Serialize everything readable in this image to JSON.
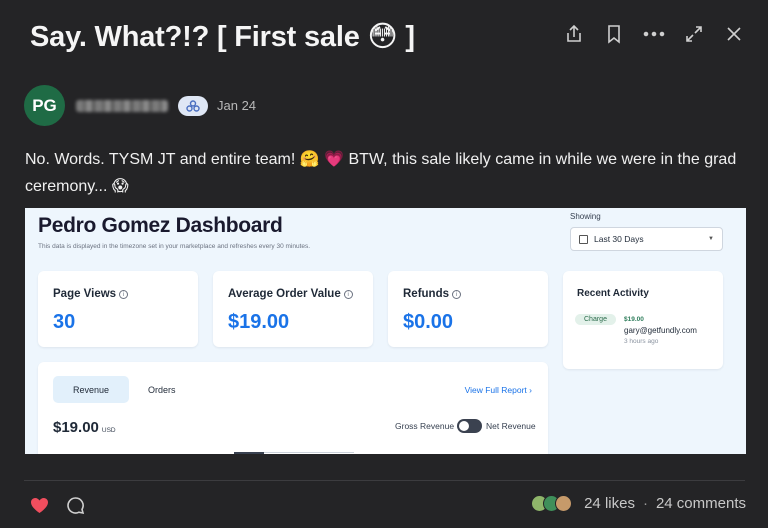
{
  "post": {
    "title": "Say. What?!? [ First sale 😳 ]",
    "author_initials": "PG",
    "date": "Jan 24",
    "body": "No. Words. TYSM JT and entire team! 🤗 💗 BTW, this sale likely came in while we were in the grad ceremony... 😱"
  },
  "top_actions": [
    "share-icon",
    "bookmark-icon",
    "more-icon",
    "expand-icon",
    "close-icon"
  ],
  "dashboard": {
    "title": "Pedro Gomez Dashboard",
    "subtitle": "This data is displayed in the timezone set in your marketplace and refreshes every 30 minutes.",
    "showing_label": "Showing",
    "range_value": "Last 30 Days",
    "metrics": [
      {
        "label": "Page Views",
        "value": "30"
      },
      {
        "label": "Average Order Value",
        "value": "$19.00"
      },
      {
        "label": "Refunds",
        "value": "$0.00"
      }
    ],
    "activity": {
      "title": "Recent Activity",
      "type": "Charge",
      "amount": "$19.00",
      "email": "gary@getfundly.com",
      "time": "3 hours ago"
    },
    "tabs": {
      "revenue": "Revenue",
      "orders": "Orders"
    },
    "full_report": "View Full Report  ›",
    "revenue_amount": "$19.00",
    "currency": "USD",
    "gross_label": "Gross Revenue",
    "net_label": "Net Revenue"
  },
  "footer": {
    "likes": "24 likes",
    "separator": "·",
    "comments": "24 comments"
  },
  "colors": {
    "background": "#242426",
    "accent_blue": "#1a73e8",
    "heart": "#f04e5e",
    "avatar": "#1f6b45"
  }
}
